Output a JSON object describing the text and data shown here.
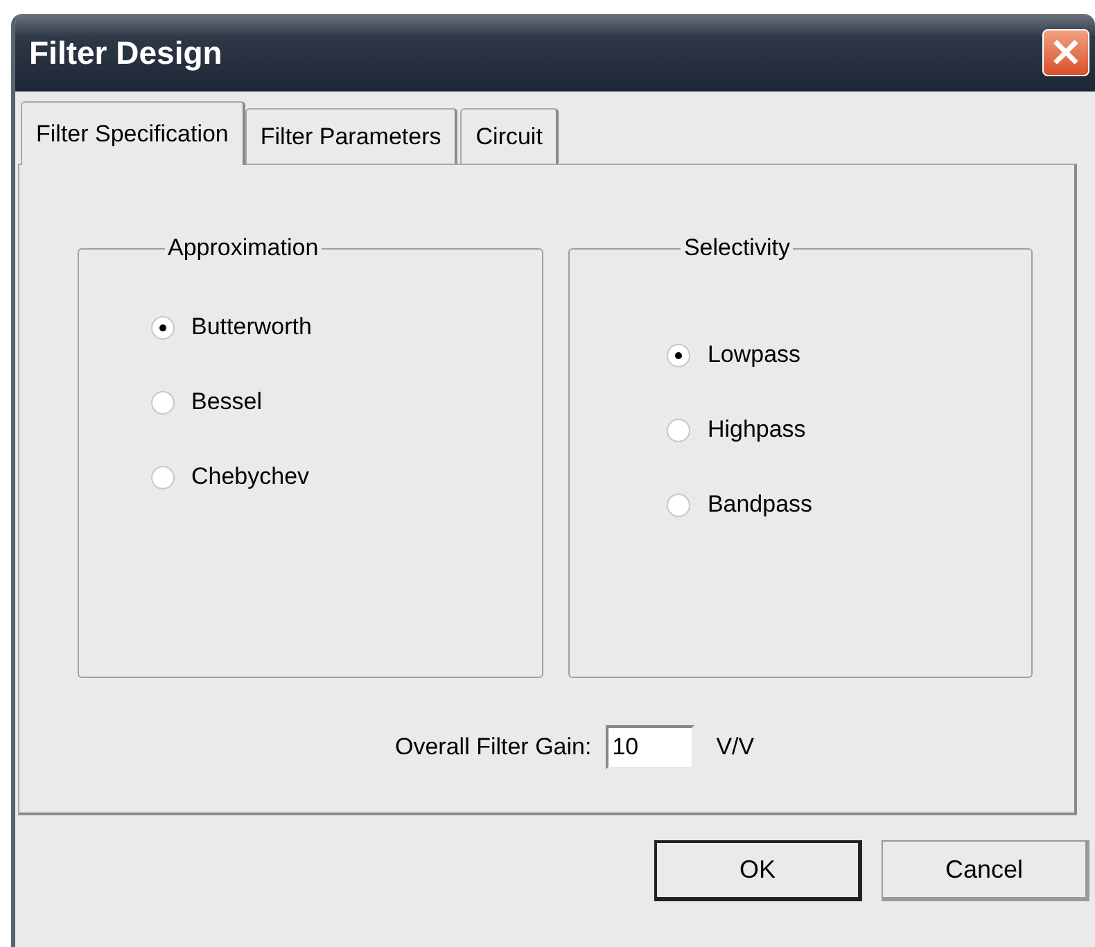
{
  "window": {
    "title": "Filter Design",
    "close": "×"
  },
  "tabs": [
    {
      "label": "Filter Specification",
      "selected": true
    },
    {
      "label": "Filter Parameters",
      "selected": false
    },
    {
      "label": "Circuit",
      "selected": false
    }
  ],
  "groups": [
    {
      "title": "Approximation",
      "options": [
        {
          "label": "Butterworth",
          "selected": true
        },
        {
          "label": "Bessel",
          "selected": false
        },
        {
          "label": "Chebychev",
          "selected": false
        }
      ]
    },
    {
      "title": "Selectivity",
      "options": [
        {
          "label": "Lowpass",
          "selected": true
        },
        {
          "label": "Highpass",
          "selected": false
        },
        {
          "label": "Bandpass",
          "selected": false
        }
      ]
    }
  ],
  "gain": {
    "label": "Overall Filter Gain:",
    "value": "10",
    "unit": "V/V"
  },
  "buttons": [
    {
      "label": "OK",
      "default": true
    },
    {
      "label": "Cancel",
      "default": false
    }
  ]
}
